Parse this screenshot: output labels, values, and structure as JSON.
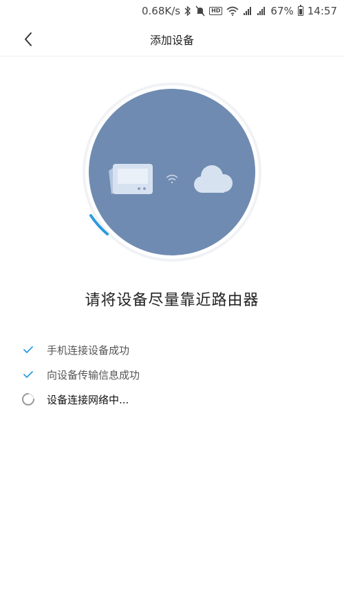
{
  "status_bar": {
    "speed": "0.68K/s",
    "battery_percent": "67%",
    "time": "14:57",
    "hd_label": "HD",
    "icons": [
      "bluetooth-icon",
      "mute-icon",
      "hd-icon",
      "wifi-icon",
      "signal-e-icon",
      "signal-4g-icon",
      "battery-icon"
    ]
  },
  "header": {
    "title": "添加设备",
    "back_icon": "chevron-left-icon"
  },
  "illustration": {
    "circle_color": "#6f8bb1",
    "progress_color": "#2a9ae0",
    "device_icon": "router-device-icon",
    "signal_icon": "wifi-signal-icon",
    "cloud_icon": "cloud-icon"
  },
  "instruction": "请将设备尽量靠近路由器",
  "steps": [
    {
      "label": "手机连接设备成功",
      "status": "done",
      "icon": "check-icon"
    },
    {
      "label": "向设备传输信息成功",
      "status": "done",
      "icon": "check-icon"
    },
    {
      "label": "设备连接网络中...",
      "status": "loading",
      "icon": "spinner-icon"
    }
  ],
  "colors": {
    "accent": "#2a9ae0",
    "check": "#2a9ae0"
  }
}
